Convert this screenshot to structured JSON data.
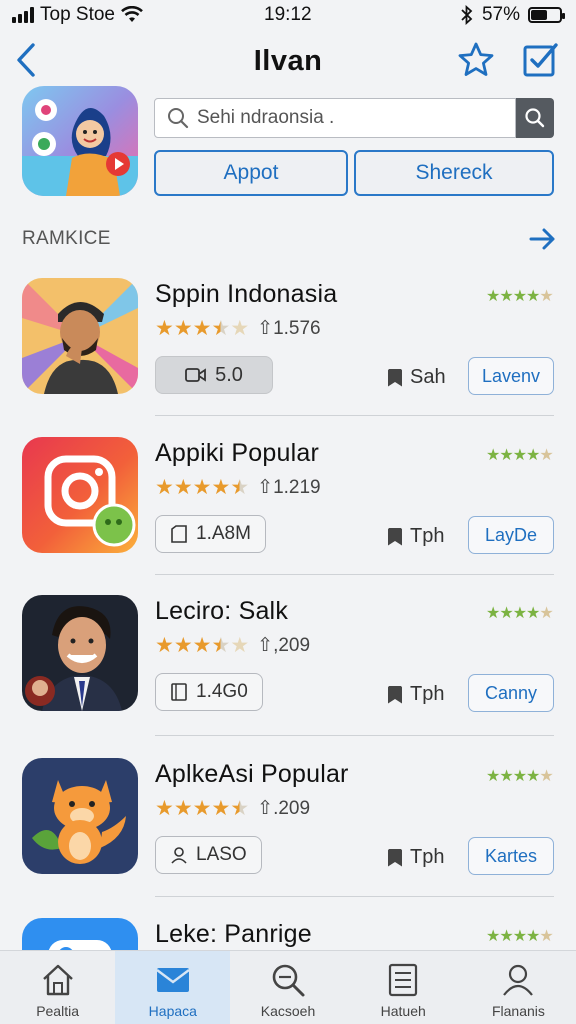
{
  "status_bar": {
    "carrier": "Top Stoe",
    "time": "19:12",
    "battery": "57%",
    "battery_level": 0.57
  },
  "nav": {
    "title": "Ilvan",
    "back_icon": "chevron-left-icon",
    "star_icon": "star-outline-icon",
    "check_icon": "checkbox-icon"
  },
  "search": {
    "placeholder": "Sehi ndraonsia ."
  },
  "segments": {
    "first": "Appot",
    "second": "Shereck"
  },
  "section": {
    "title": "RAMKICE"
  },
  "apps": [
    {
      "name": "Sppin Indonasia",
      "rating": 3.5,
      "count": "1.576",
      "count_prefix": "⇧",
      "meta": "5.0",
      "meta_style": "filled",
      "bookmark": "Sah",
      "action": "Lavenv"
    },
    {
      "name": "Appiki Popular",
      "rating": 4.5,
      "count": "1.219",
      "count_prefix": "⇧",
      "meta": "1.A8M",
      "meta_style": "outline",
      "bookmark": "Tph",
      "action": "LayDe"
    },
    {
      "name": "Leciro: Salk",
      "rating": 3.5,
      "count": ",209",
      "count_prefix": "⇧",
      "meta": "1.4G0",
      "meta_style": "outline",
      "bookmark": "Tph",
      "action": "Canny"
    },
    {
      "name": "AplkeAsi Popular",
      "rating": 4.5,
      "count": ".209",
      "count_prefix": "⇧",
      "meta": "LASO",
      "meta_style": "outline",
      "bookmark": "Tph",
      "action": "Kartes"
    },
    {
      "name": "Leke: Panrige",
      "rating": 4,
      "count": "",
      "count_prefix": "",
      "meta": "",
      "meta_style": "outline",
      "bookmark": "",
      "action": ""
    }
  ],
  "tabs": [
    {
      "label": "Pealtia",
      "icon": "home-icon",
      "active": false
    },
    {
      "label": "Hapaca",
      "icon": "mail-icon",
      "active": true
    },
    {
      "label": "Kacsoeh",
      "icon": "search-icon",
      "active": false
    },
    {
      "label": "Hatueh",
      "icon": "list-icon",
      "active": false
    },
    {
      "label": "Flananis",
      "icon": "person-icon",
      "active": false
    }
  ],
  "colors": {
    "accent": "#1f6fc0",
    "star": "#e89a2c",
    "mini_star": "#7cb342"
  }
}
